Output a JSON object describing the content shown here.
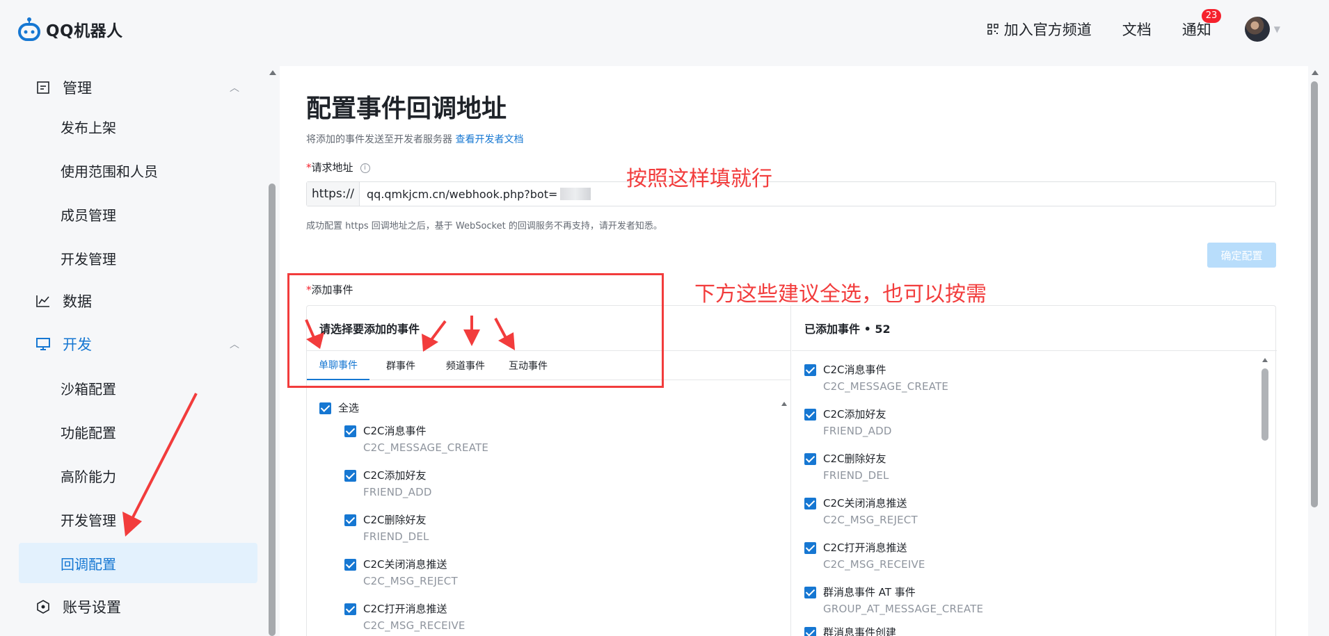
{
  "header": {
    "logo_text": "QQ机器人",
    "join_channel": "加入官方频道",
    "docs": "文档",
    "notify": "通知",
    "notify_count": "23"
  },
  "sidebar": {
    "manage": "管理",
    "manage_items": [
      "发布上架",
      "使用范围和人员",
      "成员管理",
      "开发管理"
    ],
    "data": "数据",
    "dev": "开发",
    "dev_items": [
      "沙箱配置",
      "功能配置",
      "高阶能力",
      "开发管理",
      "回调配置"
    ],
    "account": "账号设置"
  },
  "main": {
    "title": "配置事件回调地址",
    "desc": "将添加的事件发送至开发者服务器",
    "desc_link": "查看开发者文档",
    "url_label_req": "*",
    "url_label": "请求地址",
    "url_prefix": "https://",
    "url_value": "qq.qmkjcm.cn/webhook.php?bot=",
    "note": "成功配置 https 回调地址之后，基于 WebSocket 的回调服务不再支持，请开发者知悉。",
    "confirm_btn": "确定配置",
    "events_label_req": "*",
    "events_label": "添加事件",
    "choose_title": "请选择要添加的事件",
    "tabs": [
      "单聊事件",
      "群事件",
      "频道事件",
      "互动事件"
    ],
    "select_all": "全选",
    "left_events": [
      {
        "name": "C2C消息事件",
        "code": "C2C_MESSAGE_CREATE"
      },
      {
        "name": "C2C添加好友",
        "code": "FRIEND_ADD"
      },
      {
        "name": "C2C删除好友",
        "code": "FRIEND_DEL"
      },
      {
        "name": "C2C关闭消息推送",
        "code": "C2C_MSG_REJECT"
      },
      {
        "name": "C2C打开消息推送",
        "code": "C2C_MSG_RECEIVE"
      }
    ],
    "added_title": "已添加事件 • 52",
    "right_events": [
      {
        "name": "C2C消息事件",
        "code": "C2C_MESSAGE_CREATE"
      },
      {
        "name": "C2C添加好友",
        "code": "FRIEND_ADD"
      },
      {
        "name": "C2C删除好友",
        "code": "FRIEND_DEL"
      },
      {
        "name": "C2C关闭消息推送",
        "code": "C2C_MSG_REJECT"
      },
      {
        "name": "C2C打开消息推送",
        "code": "C2C_MSG_RECEIVE"
      },
      {
        "name": "群消息事件 AT 事件",
        "code": "GROUP_AT_MESSAGE_CREATE"
      },
      {
        "name": "群消息事件创建",
        "code": ""
      }
    ]
  },
  "annotations": {
    "fill_hint": "按照这样填就行",
    "select_hint": "下方这些建议全选，也可以按需"
  },
  "colors": {
    "accent": "#1677d2",
    "annotation": "#f23c3c"
  }
}
